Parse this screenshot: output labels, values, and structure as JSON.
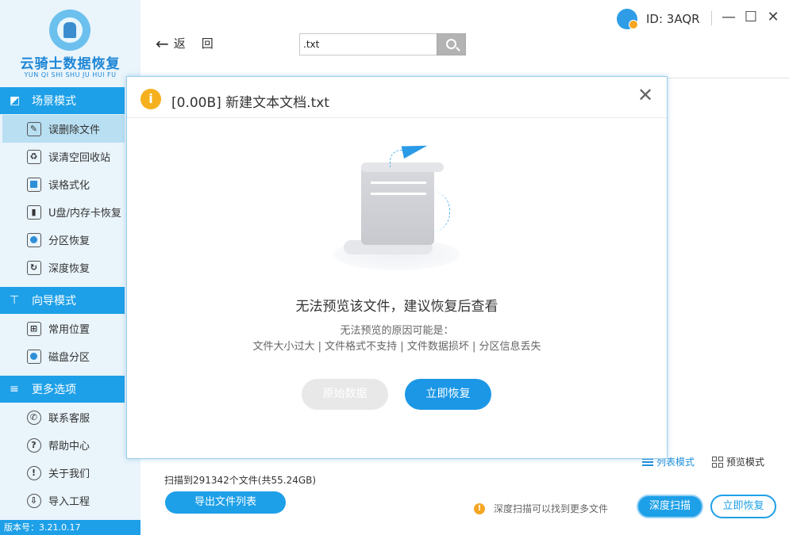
{
  "app": {
    "logo_title": "云骑士数据恢复",
    "logo_subtitle": "YUN QI SHI SHU JU HUI FU",
    "version": "版本号：3.21.0.17",
    "user_id": "ID: 3AQR",
    "accent_color": "#1ea0e8"
  },
  "sidebar": {
    "sections": [
      {
        "title": "场景模式",
        "icon": "scene-icon",
        "items": [
          {
            "label": "误删除文件",
            "icon": "deleted-file-icon",
            "active": true
          },
          {
            "label": "误清空回收站",
            "icon": "recycle-bin-icon"
          },
          {
            "label": "误格式化",
            "icon": "format-icon"
          },
          {
            "label": "U盘/内存卡恢复",
            "icon": "usb-drive-icon"
          },
          {
            "label": "分区恢复",
            "icon": "partition-icon"
          },
          {
            "label": "深度恢复",
            "icon": "deep-recovery-icon"
          }
        ]
      },
      {
        "title": "向导模式",
        "icon": "signpost-icon",
        "items": [
          {
            "label": "常用位置",
            "icon": "windows-icon"
          },
          {
            "label": "磁盘分区",
            "icon": "disk-icon"
          }
        ]
      },
      {
        "title": "更多选项",
        "icon": "menu-lines-icon",
        "items": [
          {
            "label": "联系客服",
            "icon": "phone-icon"
          },
          {
            "label": "帮助中心",
            "icon": "help-icon"
          },
          {
            "label": "关于我们",
            "icon": "info-icon"
          },
          {
            "label": "导入工程",
            "icon": "import-icon"
          }
        ]
      }
    ]
  },
  "toolbar": {
    "back_label": "返回",
    "search_value": ".txt"
  },
  "bottom": {
    "list_mode": "列表模式",
    "preview_mode": "预览模式",
    "scan_summary": "扫描到291342个文件(共55.24GB)",
    "export_label": "导出文件列表",
    "deep_hint": "深度扫描可以找到更多文件",
    "deep_scan_label": "深度扫描",
    "recover_now_label": "立即恢复"
  },
  "modal": {
    "title": "[0.00B] 新建文本文档.txt",
    "message": "无法预览该文件，建议恢复后查看",
    "reason_title": "无法预览的原因可能是：",
    "reasons": "文件大小过大 | 文件格式不支持 | 文件数据损坏 | 分区信息丢失",
    "raw_data_label": "原始数据",
    "recover_label": "立即恢复"
  }
}
